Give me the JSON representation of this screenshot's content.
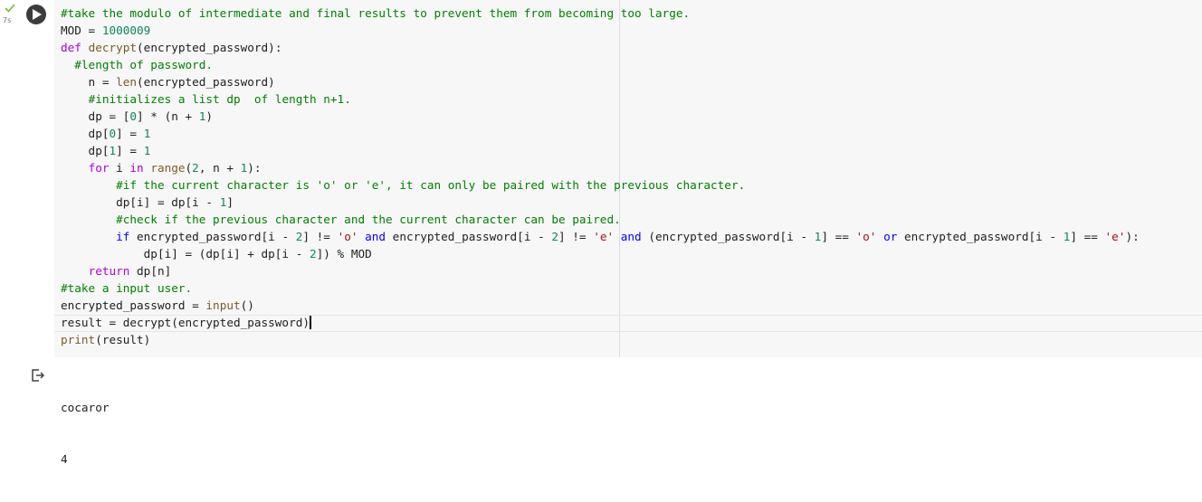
{
  "cell": {
    "exec_time": "7s",
    "run_button_label": "Run cell",
    "code_lines": [
      "#take the modulo of intermediate and final results to prevent them from becoming too large.",
      "MOD = 1000009",
      "def decrypt(encrypted_password):",
      "  #length of password.",
      "    n = len(encrypted_password)",
      "    #initializes a list dp  of length n+1.",
      "    dp = [0] * (n + 1)",
      "    dp[0] = 1",
      "    dp[1] = 1",
      "    for i in range(2, n + 1):",
      "        #if the current character is 'o' or 'e', it can only be paired with the previous character.",
      "        dp[i] = dp[i - 1]",
      "        #check if the previous character and the current character can be paired.",
      "        if encrypted_password[i - 2] != 'o' and encrypted_password[i - 2] != 'e' and (encrypted_password[i - 1] == 'o' or encrypted_password[i - 1] == 'e'):",
      "            dp[i] = (dp[i] + dp[i - 2]) % MOD",
      "    return dp[n]",
      "#take a input user.",
      "encrypted_password = input()",
      "result = decrypt(encrypted_password)",
      "print(result)"
    ]
  },
  "output": {
    "lines": [
      "cocaror",
      "4"
    ]
  }
}
